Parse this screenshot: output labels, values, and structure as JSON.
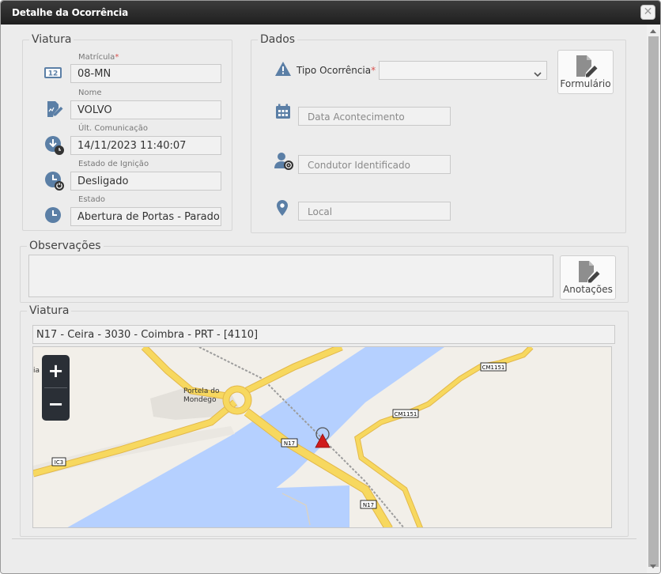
{
  "window": {
    "title": "Detalhe da Ocorrência",
    "close_label": "✕"
  },
  "viatura_panel": {
    "legend": "Viatura",
    "fields": [
      {
        "label": "Matrícula",
        "required": "*",
        "value": "08-MN"
      },
      {
        "label": "Nome",
        "value": "VOLVO"
      },
      {
        "label": "Últ. Comunicação",
        "value": "14/11/2023 11:40:07"
      },
      {
        "label": "Estado de Ignição",
        "value": "Desligado"
      },
      {
        "label": "Estado",
        "value": "Abertura de Portas - Parado"
      }
    ],
    "plate_icon_text": "12"
  },
  "dados_panel": {
    "legend": "Dados",
    "tipo_label": "Tipo Ocorrência",
    "required": "*",
    "tipo_value": "",
    "formulario_label": "Formulário",
    "data_placeholder": "Data Acontecimento",
    "condutor_placeholder": "Condutor Identificado",
    "local_placeholder": "Local"
  },
  "observacoes_panel": {
    "legend": "Observações",
    "value": "",
    "anotacoes_label": "Anotações"
  },
  "mapa_panel": {
    "legend": "Viatura",
    "address": "N17 - Ceira - 3030 - Coimbra - PRT - [4110]",
    "zoom_in": "+",
    "zoom_out": "−",
    "labels": {
      "place": "Portela do\nMondego",
      "place_line1": "Portela do",
      "place_line2": "Mondego",
      "edge_text": "ia",
      "road_n17_a": "N17",
      "road_n17_b": "N17",
      "road_ic3": "IC3",
      "road_cm1151_a": "CM1151",
      "road_cm1151_b": "CM1151"
    },
    "colors": {
      "water": "#b5d0ff",
      "road": "#f7d85f",
      "road_edge": "#e3b84a",
      "land": "#f2efe9",
      "marker": "#d01b1b"
    }
  }
}
